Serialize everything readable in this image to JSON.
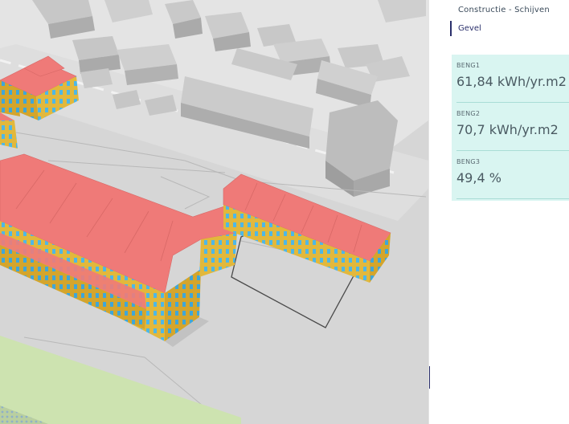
{
  "panel": {
    "breadcrumb": "Constructie - Schijven",
    "active_tab": "Gevel",
    "metrics": [
      {
        "label": "BENG1",
        "value": "61,84 kWh/yr.m2"
      },
      {
        "label": "BENG2",
        "value": "70,7 kWh/yr.m2"
      },
      {
        "label": "BENG3",
        "value": "49,4 %"
      }
    ]
  },
  "colors": {
    "roof": "#ef7a78",
    "facade": "#e2b83c",
    "window": "#4eb7e6",
    "ground": "#d6d6d6",
    "context_building": "#c3c3c3",
    "grass": "#cde3b0",
    "metrics_bg": "#d9f5f1",
    "accent": "#2a2f6b"
  }
}
